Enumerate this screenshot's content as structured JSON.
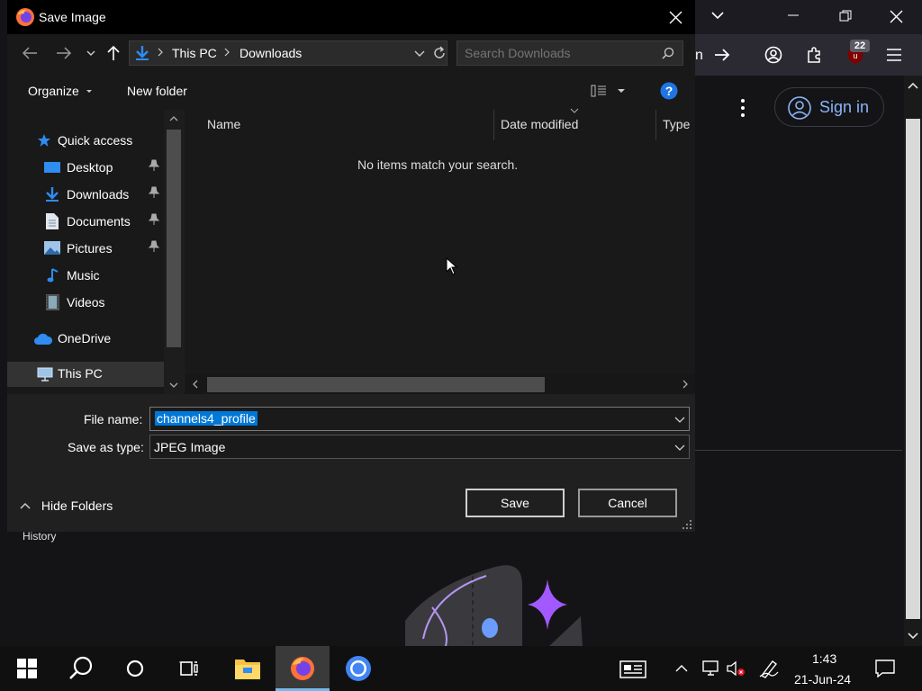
{
  "dialog": {
    "title": "Save Image",
    "breadcrumb": [
      "This PC",
      "Downloads"
    ],
    "search_placeholder": "Search Downloads",
    "toolbar": {
      "organize": "Organize",
      "new_folder": "New folder"
    },
    "nav": {
      "quick_access": "Quick access",
      "items": [
        "Desktop",
        "Downloads",
        "Documents",
        "Pictures",
        "Music",
        "Videos"
      ],
      "onedrive": "OneDrive",
      "this_pc": "This PC"
    },
    "columns": [
      "Name",
      "Date modified",
      "Type"
    ],
    "empty_message": "No items match your search.",
    "file_name_label": "File name:",
    "file_name_value": "channels4_profile",
    "save_type_label": "Save as type:",
    "save_type_value": "JPEG Image",
    "hide_folders": "Hide Folders",
    "save_button": "Save",
    "cancel_button": "Cancel"
  },
  "browser": {
    "tab_fragment": "n",
    "extension_badge": "22",
    "sign_in": "Sign in",
    "history_label": "History"
  },
  "taskbar": {
    "time": "1:43",
    "date": "21-Jun-24"
  },
  "colors": {
    "accent": "#0078d7",
    "selection": "#0078d7",
    "link": "#8ab4f8",
    "sparkle": "#a259ff"
  }
}
